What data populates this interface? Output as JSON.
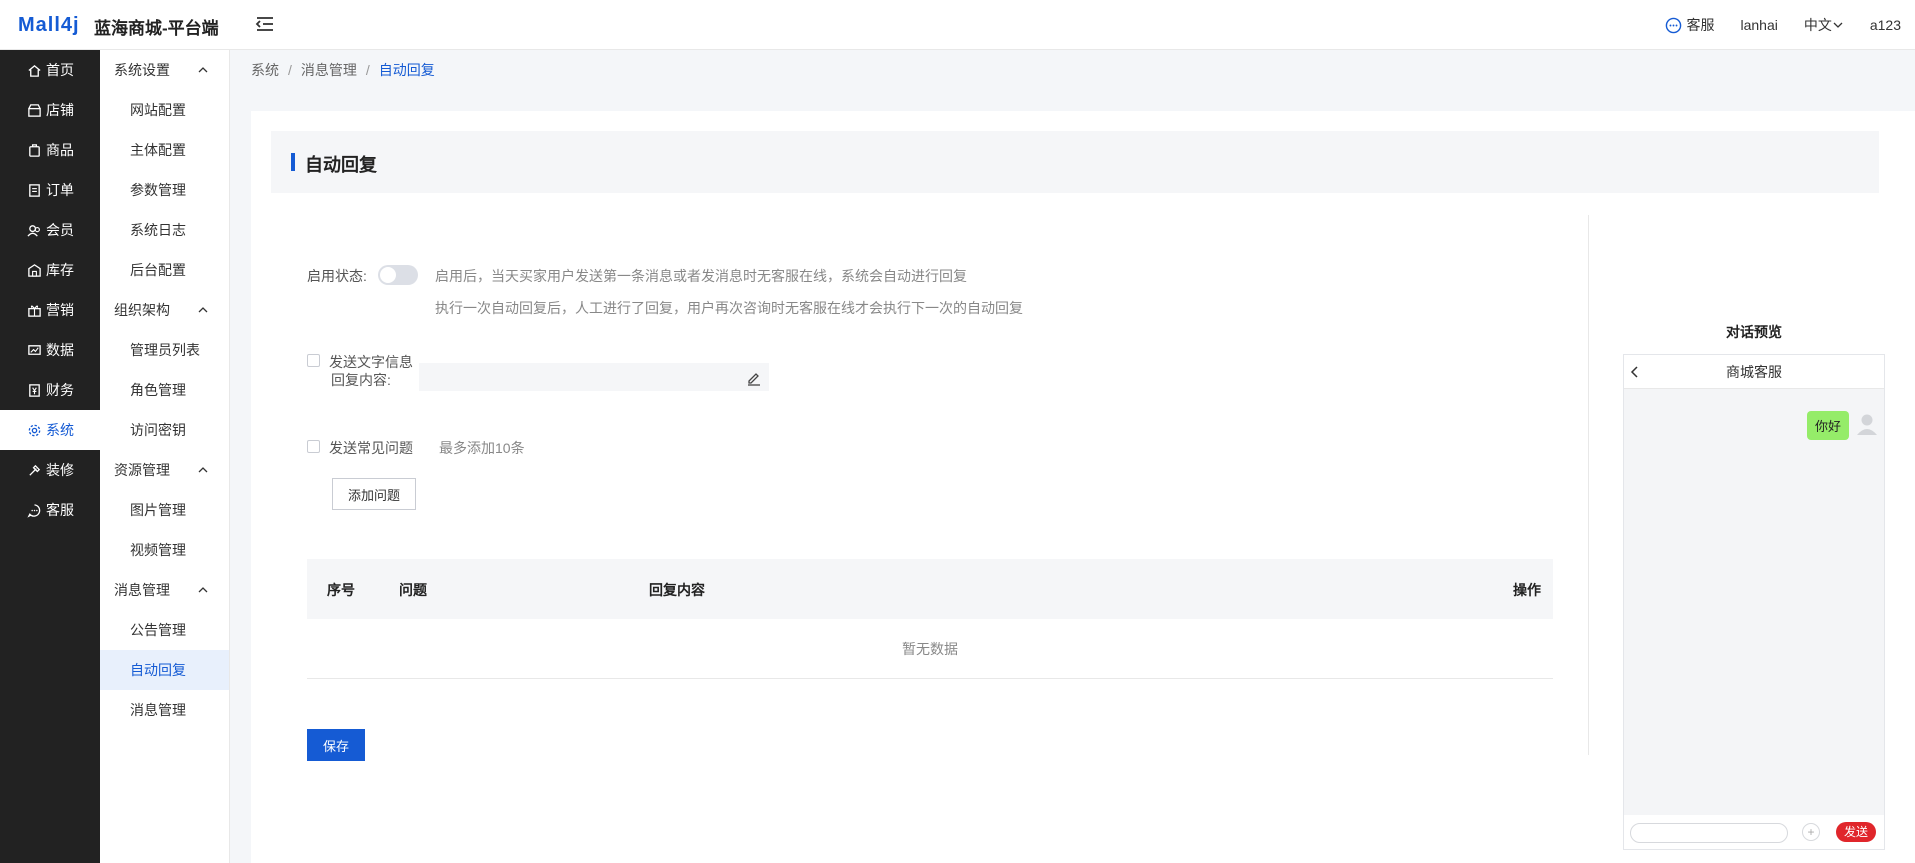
{
  "header": {
    "logo": "Mall4j",
    "title": "蓝海商城-平台端",
    "customer_service": "客服",
    "username": "lanhai",
    "language": "中文",
    "account": "a123"
  },
  "nav": {
    "items": [
      {
        "label": "首页",
        "icon": "home-icon"
      },
      {
        "label": "店铺",
        "icon": "shop-icon"
      },
      {
        "label": "商品",
        "icon": "product-icon"
      },
      {
        "label": "订单",
        "icon": "order-icon"
      },
      {
        "label": "会员",
        "icon": "member-icon"
      },
      {
        "label": "库存",
        "icon": "inventory-icon"
      },
      {
        "label": "营销",
        "icon": "gift-icon"
      },
      {
        "label": "数据",
        "icon": "data-icon"
      },
      {
        "label": "财务",
        "icon": "finance-icon"
      },
      {
        "label": "系统",
        "icon": "gear-icon",
        "active": true
      },
      {
        "label": "装修",
        "icon": "decorate-icon"
      },
      {
        "label": "客服",
        "icon": "chat-icon"
      }
    ]
  },
  "subnav": {
    "groups": [
      {
        "label": "系统设置",
        "items": [
          "网站配置",
          "主体配置",
          "参数管理",
          "系统日志",
          "后台配置"
        ]
      },
      {
        "label": "组织架构",
        "items": [
          "管理员列表",
          "角色管理",
          "访问密钥"
        ]
      },
      {
        "label": "资源管理",
        "items": [
          "图片管理",
          "视频管理"
        ]
      },
      {
        "label": "消息管理",
        "items": [
          "公告管理",
          "自动回复",
          "消息管理"
        ]
      }
    ],
    "active_item": "自动回复"
  },
  "breadcrumb": [
    "系统",
    "消息管理",
    "自动回复"
  ],
  "page": {
    "title": "自动回复",
    "status_label": "启用状态:",
    "status_enabled": false,
    "tip_line1": "启用后，当天买家用户发送第一条消息或者发消息时无客服在线，系统会自动进行回复",
    "tip_line2": "执行一次自动回复后，人工进行了回复，用户再次咨询时无客服在线才会执行下一次的自动回复",
    "send_text_label": "发送文字信息",
    "reply_label": "回复内容:",
    "reply_value": "",
    "send_faq_label": "发送常见问题",
    "faq_hint": "最多添加10条",
    "add_question_button": "添加问题",
    "table": {
      "columns": [
        "序号",
        "问题",
        "回复内容",
        "操作"
      ],
      "empty_text": "暂无数据"
    },
    "save_button": "保存"
  },
  "preview": {
    "title": "对话预览",
    "chat_title": "商城客服",
    "message": "你好",
    "send_button": "发送",
    "plus": "+"
  },
  "colors": {
    "accent": "#155bd4",
    "nav_bg": "#222222",
    "bubble": "#95ec69",
    "send": "#e0262b"
  }
}
